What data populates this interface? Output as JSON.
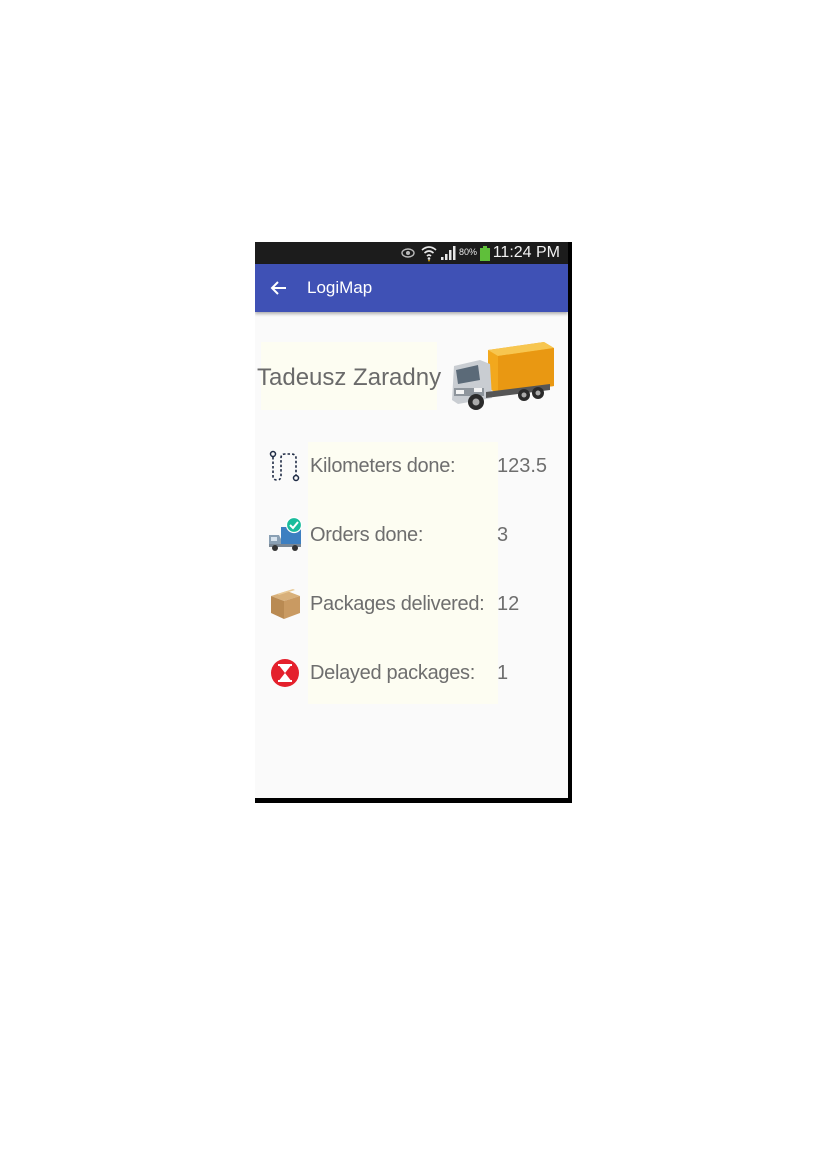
{
  "status_bar": {
    "battery_percent": "80%",
    "time": "11:24 PM"
  },
  "app_bar": {
    "title": "LogiMap",
    "back_icon": "arrow-left-icon",
    "color": "#3f51b5"
  },
  "profile": {
    "name": "Tadeusz Zaradny",
    "avatar_icon": "truck-icon"
  },
  "stats": [
    {
      "icon": "route-icon",
      "label": "Kilometers done:",
      "value": "123.5"
    },
    {
      "icon": "truck-check-icon",
      "label": "Orders done:",
      "value": "3"
    },
    {
      "icon": "package-icon",
      "label": "Packages delivered:",
      "value": "12"
    },
    {
      "icon": "hourglass-icon",
      "label": "Delayed packages:",
      "value": "1"
    }
  ]
}
